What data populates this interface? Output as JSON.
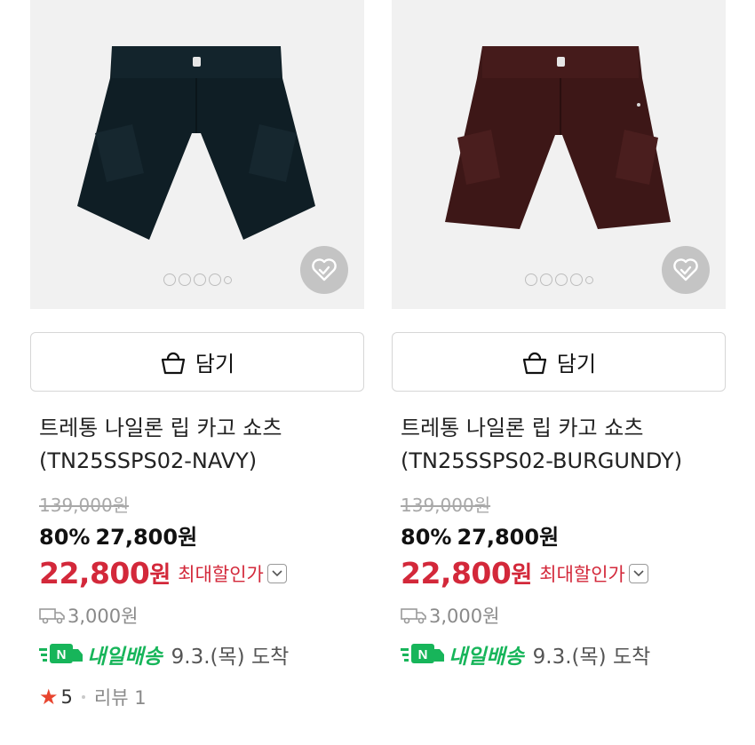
{
  "products": [
    {
      "image_alt": "navy cargo shorts",
      "color": "#0f1e25",
      "cart_label": "담기",
      "title_line1": "트레통 나일론 립 카고 쇼츠",
      "title_line2": "(TN25SSPS02-NAVY)",
      "original_price": "139,000원",
      "discount_pct": "80%",
      "sale_price": "27,800원",
      "best_price": "22,800",
      "best_price_unit": "원",
      "max_discount_label": "최대할인가",
      "shipping_fee": "3,000원",
      "delivery_badge": "N",
      "delivery_label": "내일배송",
      "arrival_text": "9.3.(목) 도착",
      "rating": "5",
      "review_text": "리뷰 1"
    },
    {
      "image_alt": "burgundy cargo shorts",
      "color": "#3d1717",
      "cart_label": "담기",
      "title_line1": "트레통 나일론 립 카고 쇼츠",
      "title_line2": "(TN25SSPS02-BURGUNDY)",
      "original_price": "139,000원",
      "discount_pct": "80%",
      "sale_price": "27,800원",
      "best_price": "22,800",
      "best_price_unit": "원",
      "max_discount_label": "최대할인가",
      "shipping_fee": "3,000원",
      "delivery_badge": "N",
      "delivery_label": "내일배송",
      "arrival_text": "9.3.(목) 도착",
      "rating": null,
      "review_text": null
    }
  ],
  "colors": {
    "price_red": "#d3283a",
    "delivery_green": "#17b55a",
    "star": "#e8452f"
  }
}
